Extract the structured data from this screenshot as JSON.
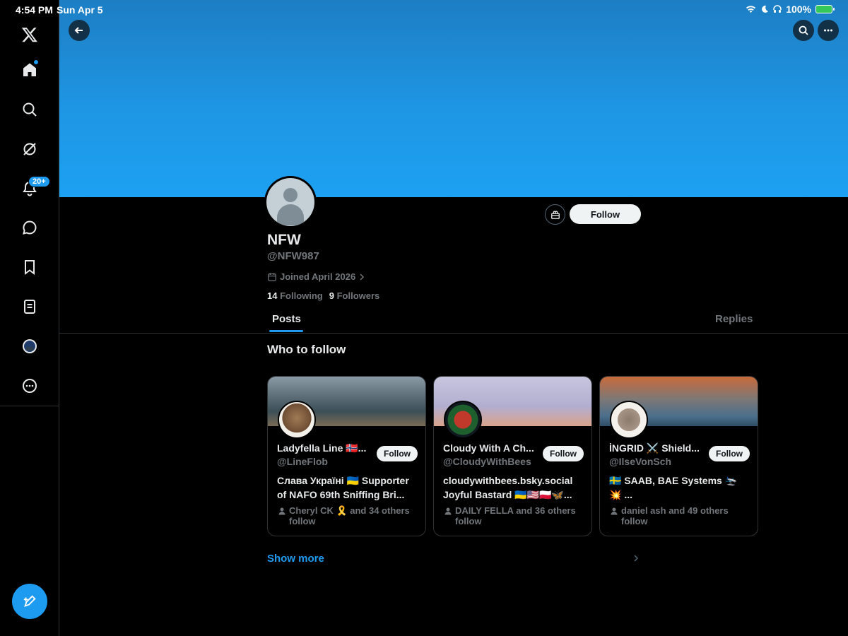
{
  "statusbar": {
    "time": "4:54 PM",
    "date": "Sun Apr 5",
    "battery": "100%"
  },
  "sidebar": {
    "items": [
      {
        "name": "x-logo"
      },
      {
        "name": "home"
      },
      {
        "name": "search"
      },
      {
        "name": "grok"
      },
      {
        "name": "notifications",
        "badge": "20+"
      },
      {
        "name": "messages"
      },
      {
        "name": "bookmarks"
      },
      {
        "name": "lists"
      },
      {
        "name": "profile"
      },
      {
        "name": "more"
      }
    ]
  },
  "profile": {
    "name": "NFW",
    "handle": "@NFW987",
    "joined": "Joined April 2026",
    "following_count": "14",
    "following_label": "Following",
    "followers_count": "9",
    "followers_label": "Followers",
    "follow_label": "Follow"
  },
  "tabs": [
    {
      "label": "Posts"
    },
    {
      "label": "Replies"
    }
  ],
  "who_to_follow": {
    "title": "Who to follow",
    "show_more": "Show more",
    "cards": [
      {
        "name": "Ladyfella Line 🇳🇴...",
        "handle": "@LineFlob",
        "bio": "Слава Україні 🇺🇦 Supporter of NAFO 69th Sniffing Bri...",
        "mutual": "Cheryl CK 🎗️ and 34 others follow",
        "follow_label": "Follow"
      },
      {
        "name": "Cloudy With A Ch...",
        "handle": "@CloudyWithBees",
        "bio": "cloudywithbees.bsky.social Joyful Bastard 🇺🇦🇺🇸🇵🇱🦋...",
        "mutual": "DAILY FELLA and 36 others follow",
        "follow_label": "Follow"
      },
      {
        "name": "İNGRID ⚔️ Shield...",
        "handle": "@IlseVonSch",
        "bio": "🇸🇪 SAAB, BAE Systems 🛬 💥 ...",
        "mutual": "daniel ash and 49 others follow",
        "follow_label": "Follow"
      }
    ]
  },
  "colors": {
    "accent": "#1d9bf0",
    "banner": "#1da1f2",
    "background": "#000000"
  }
}
